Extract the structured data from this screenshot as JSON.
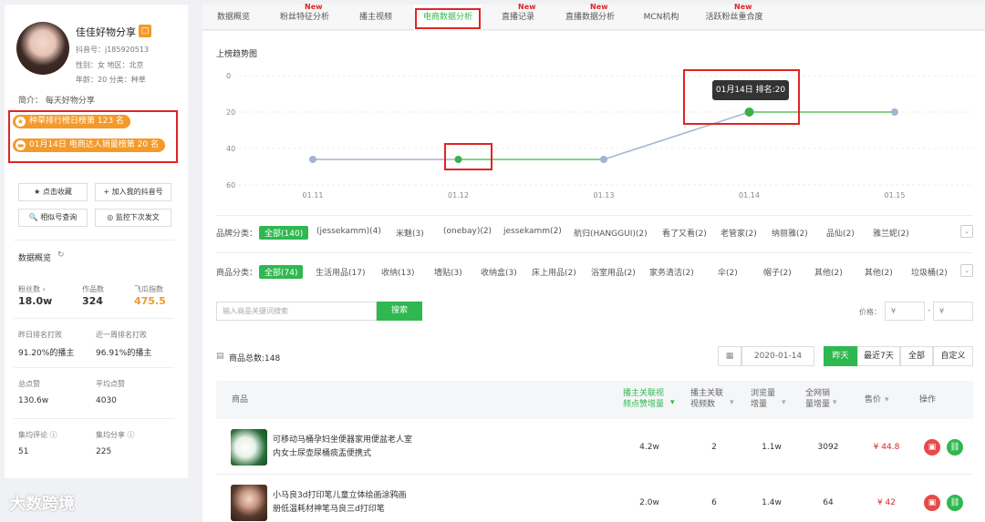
{
  "profile": {
    "name": "佳佳好物分享",
    "badge": "□",
    "douyin": "抖音号：j185920513",
    "gender_region": "性别：女   地区：北京",
    "age_cat": "年龄：20   分类：种草",
    "bio": "简介：  每天好物分享"
  },
  "ranks": [
    {
      "icon": "★",
      "label": "种草排行榜日榜第 123 名"
    },
    {
      "icon": "▬",
      "label": "01月14日 电商达人销量榜第 20 名"
    }
  ],
  "actions": {
    "collect": "★ 点击收藏",
    "add": "+ 加入我的抖音号",
    "similar": "🔍 相似号查询",
    "monitor": "◎ 监控下次发文"
  },
  "stats": {
    "title": "数据概览",
    "refresh": "↻",
    "fans_label": "粉丝数 ›",
    "fans": "18.0w",
    "works_label": "作品数",
    "works": "324",
    "index_label": "飞瓜指数",
    "index": "475.5",
    "yday_label": "昨日排名打败",
    "yday": "91.20%的播主",
    "week_label": "近一周排名打败",
    "week": "96.91%的播主",
    "likes_label": "总点赞",
    "likes": "130.6w",
    "avglikes_label": "平均点赞",
    "avglikes": "4030",
    "comments_label": "集均评论 ⓘ",
    "comments": "51",
    "shares_label": "集均分享 ⓘ",
    "shares": "225"
  },
  "tabs": [
    {
      "label": "数据概览",
      "new": ""
    },
    {
      "label": "粉丝特征分析",
      "new": "New"
    },
    {
      "label": "播主视频",
      "new": ""
    },
    {
      "label": "电商数据分析",
      "new": ""
    },
    {
      "label": "直播记录",
      "new": "New"
    },
    {
      "label": "直播数据分析",
      "new": "New"
    },
    {
      "label": "MCN机构",
      "new": ""
    },
    {
      "label": "活跃粉丝重合度",
      "new": "New"
    }
  ],
  "chart_data": {
    "type": "line",
    "title": "上榜趋势图",
    "categories": [
      "01.11",
      "01.12",
      "01.13",
      "01.14",
      "01.15"
    ],
    "values": [
      46,
      46,
      46,
      20,
      20
    ],
    "ylim": [
      0,
      60
    ],
    "yticks": [
      "0",
      "20",
      "40",
      "60"
    ],
    "tooltip": "01月14日 排名:20",
    "inverted_y": true
  },
  "brand": {
    "label": "品牌分类：",
    "items": [
      "全部(140)",
      "(jessekamm)(4)",
      "米魅(3)",
      "(onebay)(2)",
      "jessekamm(2)",
      "航归(HANGGUI)(2)",
      "看了又看(2)",
      "老管家(2)",
      "纳丽雅(2)",
      "品仙(2)",
      "雅兰妮(2)"
    ]
  },
  "goods": {
    "label": "商品分类：",
    "items": [
      "全部(74)",
      "生活用品(17)",
      "收纳(13)",
      "墙贴(3)",
      "收纳盒(3)",
      "床上用品(2)",
      "浴室用品(2)",
      "家务清洁(2)",
      "伞(2)",
      "帽子(2)",
      "其他(2)",
      "其他(2)",
      "垃圾桶(2)"
    ]
  },
  "search": {
    "placeholder": "输入商品关键词搜索",
    "button": "搜索",
    "price_label": "价格：",
    "min": "¥",
    "dash": "-",
    "max": "¥"
  },
  "total": "商品总数:148",
  "date": {
    "value": "2020-01-14",
    "segments": [
      "昨天",
      "最近7天",
      "全部",
      "自定义"
    ]
  },
  "table": {
    "headers": [
      "商品",
      "播主关联视频点赞增量",
      "播主关联视频数",
      "浏览量增量",
      "全网销量增量",
      "售价",
      "操作"
    ],
    "rows": [
      {
        "title1": "可移动马桶孕妇坐便器家用便盆老人室",
        "title2": "内女士尿壶尿桶痰盂便携式",
        "likes": "4.2w",
        "videos": "2",
        "views": "1.1w",
        "sales": "3092",
        "price": "¥ 44.8"
      },
      {
        "title1": "小马良3d打印笔儿童立体绘画涂鸦画",
        "title2": "册低温耗材神笔马良三d打印笔",
        "likes": "2.0w",
        "videos": "6",
        "views": "1.4w",
        "sales": "64",
        "price": "¥ 42"
      }
    ]
  },
  "watermark": "大数跨境"
}
